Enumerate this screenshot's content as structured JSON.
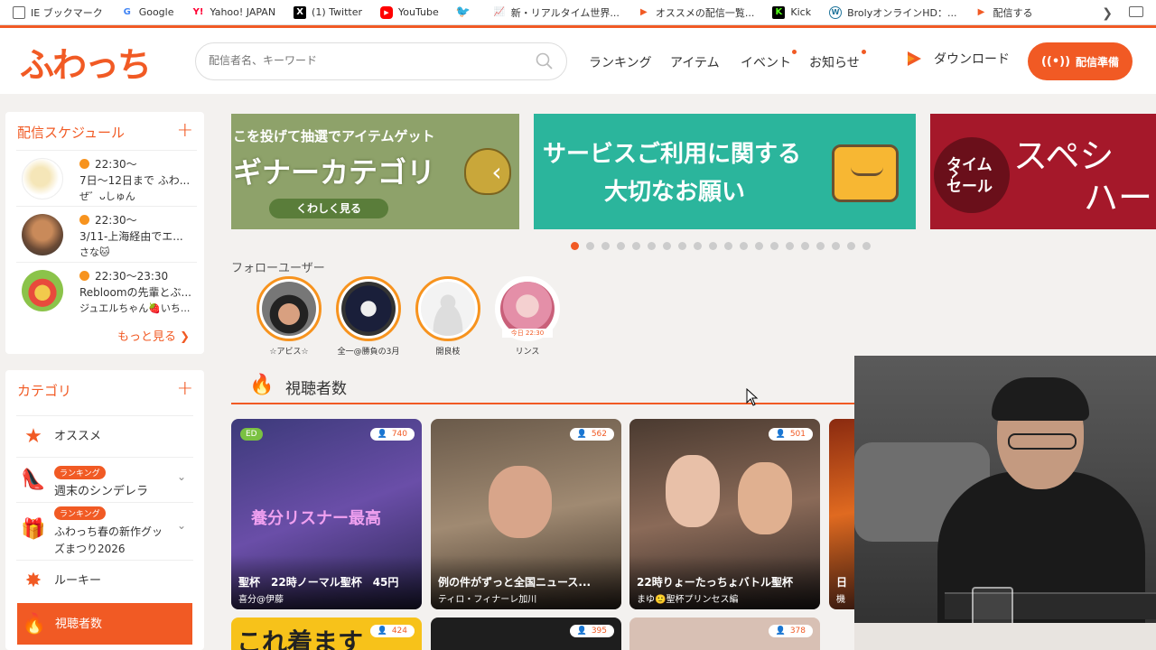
{
  "bookmarks": [
    {
      "label": "IE ブックマーク",
      "icon": "folder-icon"
    },
    {
      "label": "Google",
      "icon": "google-icon"
    },
    {
      "label": "Yahoo! JAPAN",
      "icon": "yahoo-icon"
    },
    {
      "label": "(1) Twitter",
      "icon": "x-icon"
    },
    {
      "label": "YouTube",
      "icon": "youtube-icon"
    },
    {
      "label": "",
      "icon": "twitter-bird-icon"
    },
    {
      "label": "新・リアルタイム世界...",
      "icon": "chart-icon"
    },
    {
      "label": "オススメの配信一覧...",
      "icon": "fuwacchi-icon"
    },
    {
      "label": "Kick",
      "icon": "kick-icon"
    },
    {
      "label": "BrolyオンラインHD：...",
      "icon": "wordpress-icon"
    },
    {
      "label": "配信する",
      "icon": "fuwacchi-icon"
    }
  ],
  "header": {
    "logo": "ふわっち",
    "search_placeholder": "配信者名、キーワード",
    "nav": [
      "ランキング",
      "アイテム",
      "イベント",
      "お知らせ"
    ],
    "download": "ダウンロード",
    "prep_button": "配信準備"
  },
  "schedule": {
    "title": "配信スケジュール",
    "items": [
      {
        "time": "22:30～",
        "text": "7日～12日まで ふわ...",
        "user": "ぜ゛ᴗしゅん"
      },
      {
        "time": "22:30～",
        "text": "3/11-上海経由でエ...",
        "user": "さな🐱"
      },
      {
        "time": "22:30～23:30",
        "text": "Rebloomの先輩とぶ...",
        "user": "ジュエルちゃん🍓いち..."
      }
    ],
    "more": "もっと見る"
  },
  "categories": {
    "title": "カテゴリ",
    "items": [
      {
        "label": "オススメ",
        "badge": ""
      },
      {
        "label": "週末のシンデレラ",
        "badge": "ランキング"
      },
      {
        "label": "ふわっち春の新作グッズまつり2026",
        "badge": "ランキング"
      },
      {
        "label": "ルーキー",
        "badge": ""
      },
      {
        "label": "視聴者数",
        "badge": ""
      }
    ]
  },
  "banners": [
    {
      "line1": "こを投げて抽選でアイテムゲット",
      "line2": "ギナーカテゴリ",
      "button": "くわしく見る"
    },
    {
      "line1": "サービスご利用に関する",
      "line2": "大切なお願い"
    },
    {
      "line1": "タイム",
      "line2": "セール",
      "line3": "スペシ",
      "line4": "ハー"
    }
  ],
  "carousel": {
    "total": 20,
    "active": 0
  },
  "follow": {
    "title": "フォローユーザー",
    "users": [
      {
        "name": "☆アビス☆",
        "badge": ""
      },
      {
        "name": "全一@勝負の3月",
        "badge": ""
      },
      {
        "name": "開良枝",
        "badge": ""
      },
      {
        "name": "リンス",
        "badge": "今日 22:30"
      }
    ]
  },
  "viewers_section": {
    "title": "視聴者数"
  },
  "streams": [
    {
      "viewers": "740",
      "title": "聖杯　22時ノーマル聖杯　45円",
      "user": "喜分@伊藤",
      "overlay": "養分リスナー最高",
      "tag": "ED"
    },
    {
      "viewers": "562",
      "title": "例の件がずっと全国ニュース...",
      "user": "ティロ・フィナーレ加川"
    },
    {
      "viewers": "501",
      "title": "22時りょーたっちょバトル聖杯",
      "user": "まゆ🙂聖杯プリンセス編"
    },
    {
      "viewers": "",
      "title": "日",
      "user": "機"
    }
  ],
  "streams_row2": [
    {
      "viewers": "424",
      "title": "これ着ます"
    },
    {
      "viewers": "395"
    },
    {
      "viewers": "378"
    },
    {
      "viewers": ""
    }
  ],
  "colors": {
    "accent": "#f15a24",
    "accent2": "#f7931e"
  }
}
